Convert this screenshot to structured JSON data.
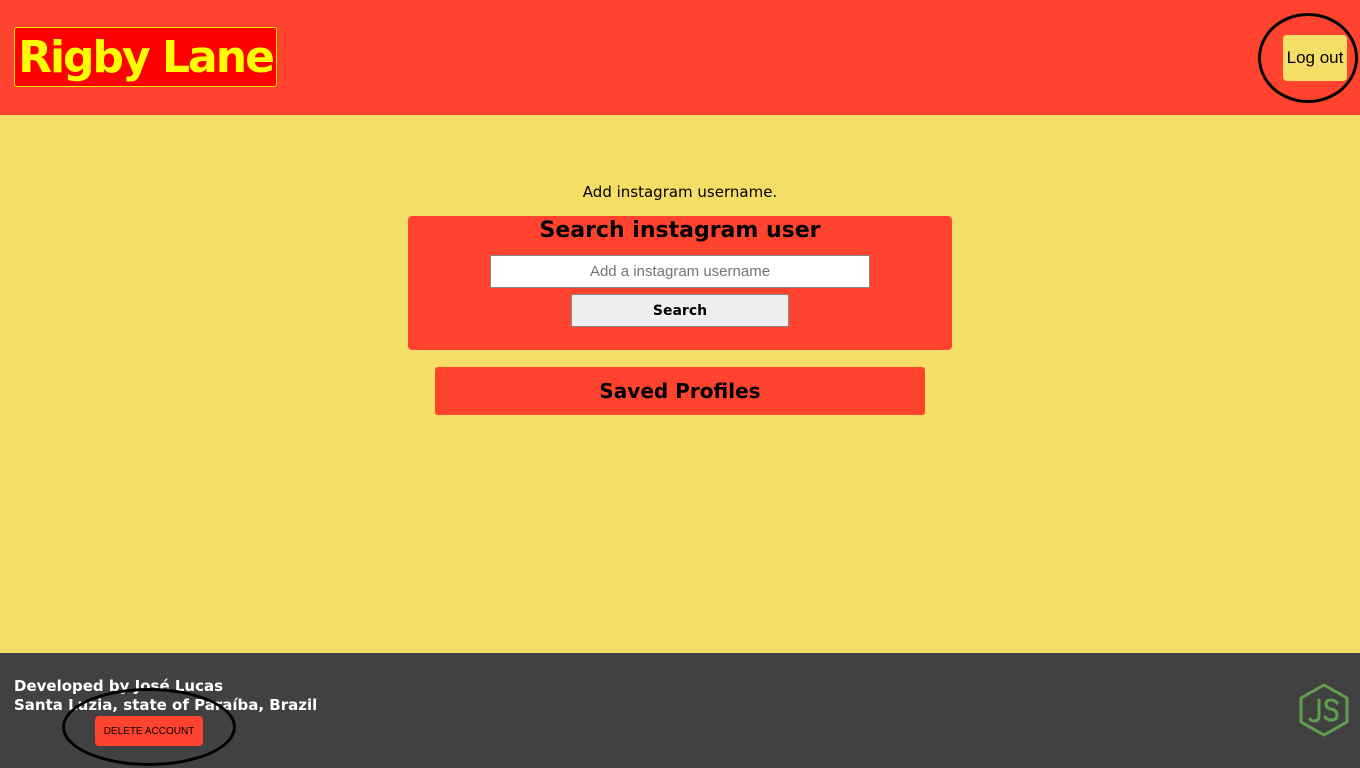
{
  "header": {
    "logo_text": "Rigby Lane",
    "logout_label": "Log out"
  },
  "main": {
    "instruction": "Add instagram username.",
    "search_card": {
      "title": "Search instagram user",
      "input_placeholder": "Add a instagram username",
      "input_value": "",
      "search_label": "Search"
    },
    "saved_profiles_label": "Saved Profiles"
  },
  "footer": {
    "developer_line": "Developed by José Lucas",
    "location_line": "Santa Luzia, state of Paraíba, Brazil",
    "delete_label": "DELETE ACCOUNT",
    "tech_icon": "nodejs-icon"
  },
  "colors": {
    "header_bg": "#ff432f",
    "page_bg": "#f4de66",
    "logo_bg": "#ff0000",
    "logo_text": "#ffff00",
    "footer_bg": "#414141",
    "nodejs_green": "#5fa04e"
  }
}
